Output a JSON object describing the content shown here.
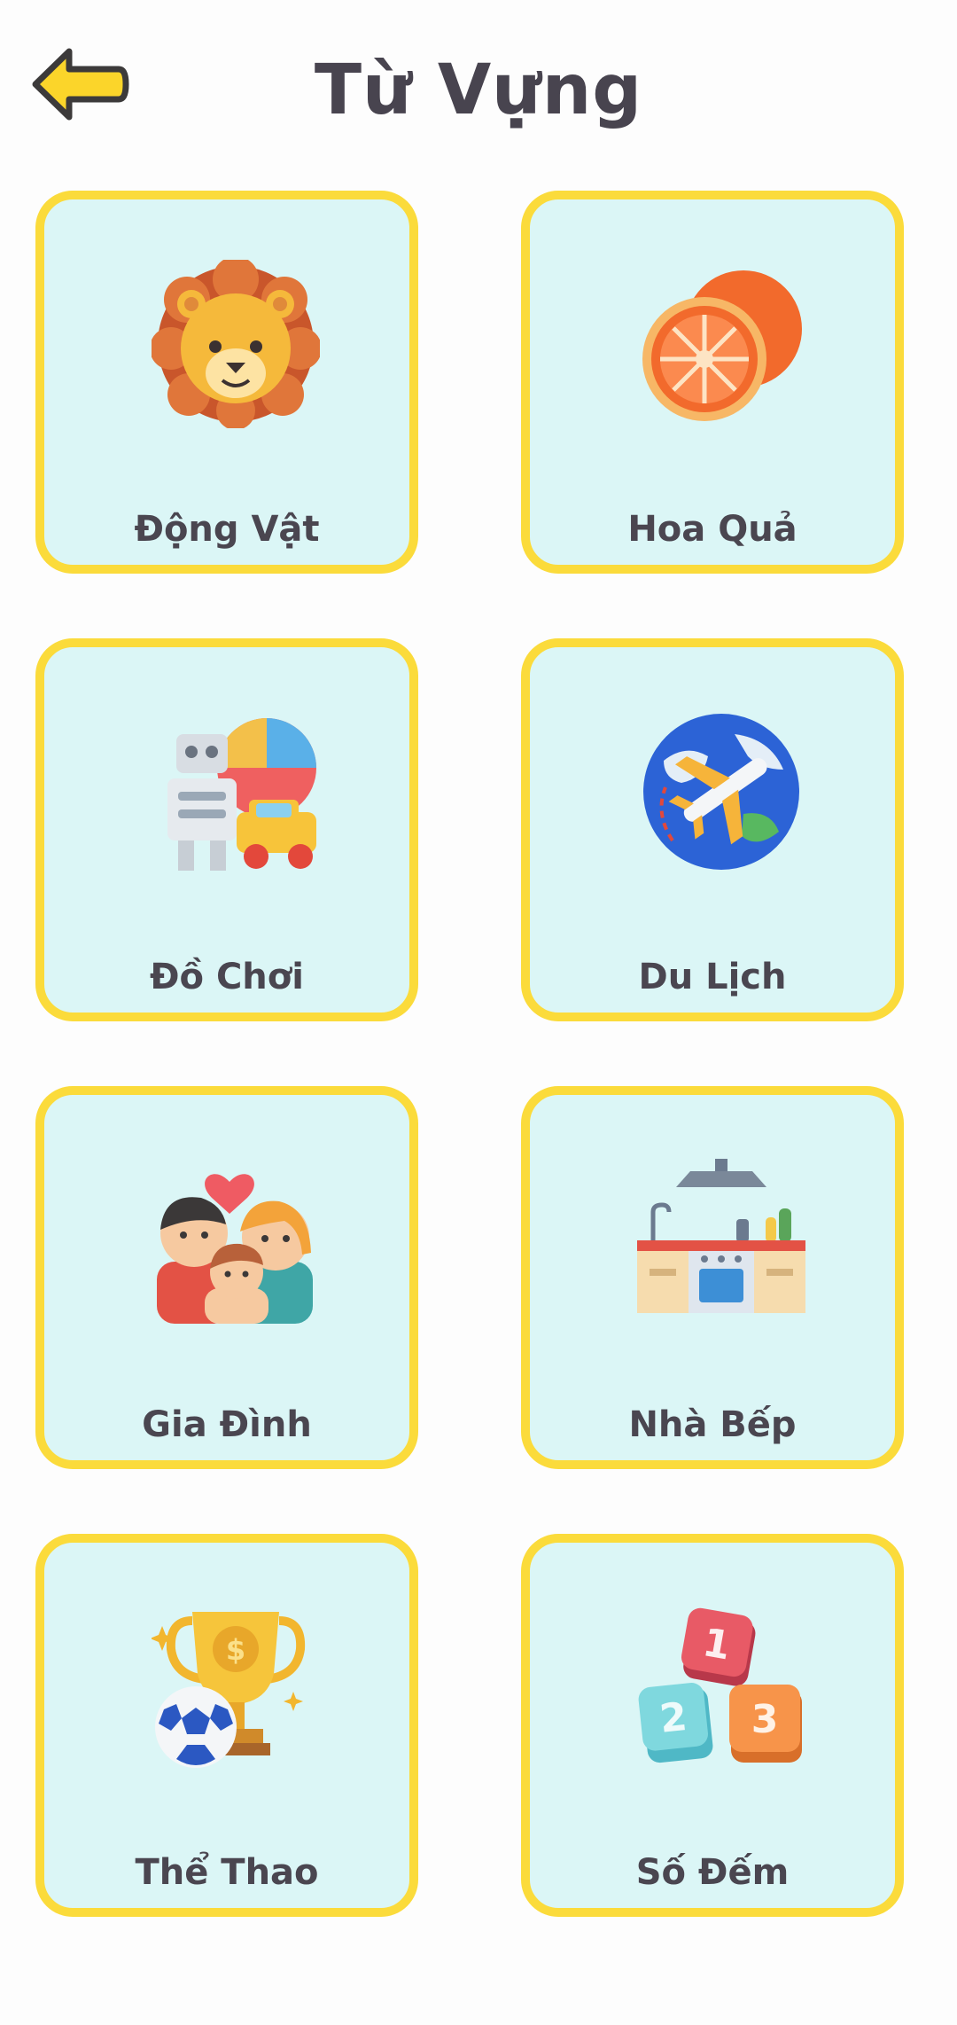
{
  "header": {
    "title": "Từ Vựng",
    "back_icon": "arrow-left-icon"
  },
  "colors": {
    "card_border": "#fbdb3b",
    "card_background": "#dbf6f6",
    "text": "#48444f",
    "back_arrow": "#fbd52a"
  },
  "categories": [
    {
      "label": "Động Vật",
      "icon": "lion-icon"
    },
    {
      "label": "Hoa Quả",
      "icon": "orange-fruit-icon"
    },
    {
      "label": "Đồ Chơi",
      "icon": "toys-robot-icon"
    },
    {
      "label": "Du Lịch",
      "icon": "globe-airplane-icon"
    },
    {
      "label": "Gia Đình",
      "icon": "family-icon"
    },
    {
      "label": "Nhà Bếp",
      "icon": "kitchen-icon"
    },
    {
      "label": "Thể Thao",
      "icon": "trophy-ball-icon"
    },
    {
      "label": "Số Đếm",
      "icon": "number-blocks-icon"
    }
  ],
  "blocks": [
    "1",
    "2",
    "3"
  ]
}
